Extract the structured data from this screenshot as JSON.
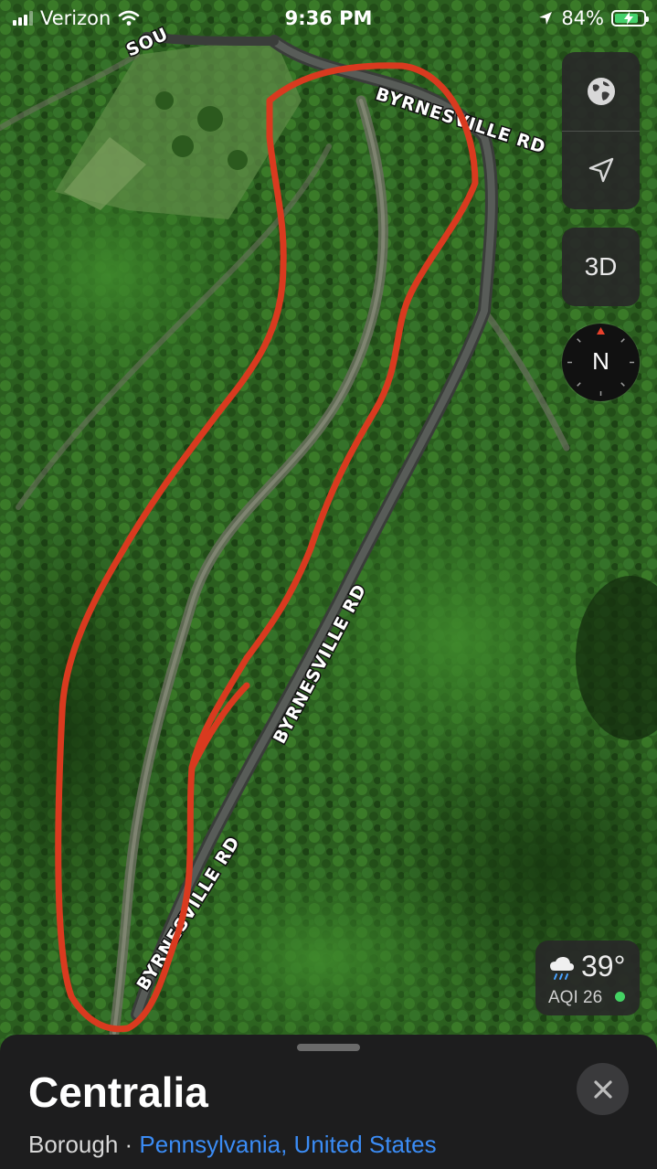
{
  "status_bar": {
    "carrier": "Verizon",
    "time": "9:36 PM",
    "battery_percent": "84%",
    "battery_level": 0.84,
    "icons": [
      "signal-icon",
      "wifi-icon",
      "location-arrow-icon",
      "battery-charging-icon"
    ]
  },
  "map": {
    "type": "satellite",
    "road_labels": [
      "SOU",
      "BYRNESVILLE RD",
      "BYRNESVILLE RD",
      "BYRNESVILLE RD"
    ],
    "annotation_color": "#d93a1f"
  },
  "controls": {
    "globe_icon": "globe-icon",
    "location_icon": "location-arrow-icon",
    "view_3d_label": "3D",
    "compass_label": "N"
  },
  "weather": {
    "icon": "rain-cloud-icon",
    "temperature": "39°",
    "aqi": "AQI 26",
    "aqi_color": "#44d163"
  },
  "place_card": {
    "title": "Centralia",
    "category": "Borough",
    "separator": " · ",
    "location_link": "Pennsylvania, United States"
  },
  "colors": {
    "link": "#3b8cf5",
    "panel": "#1d1d1e"
  }
}
